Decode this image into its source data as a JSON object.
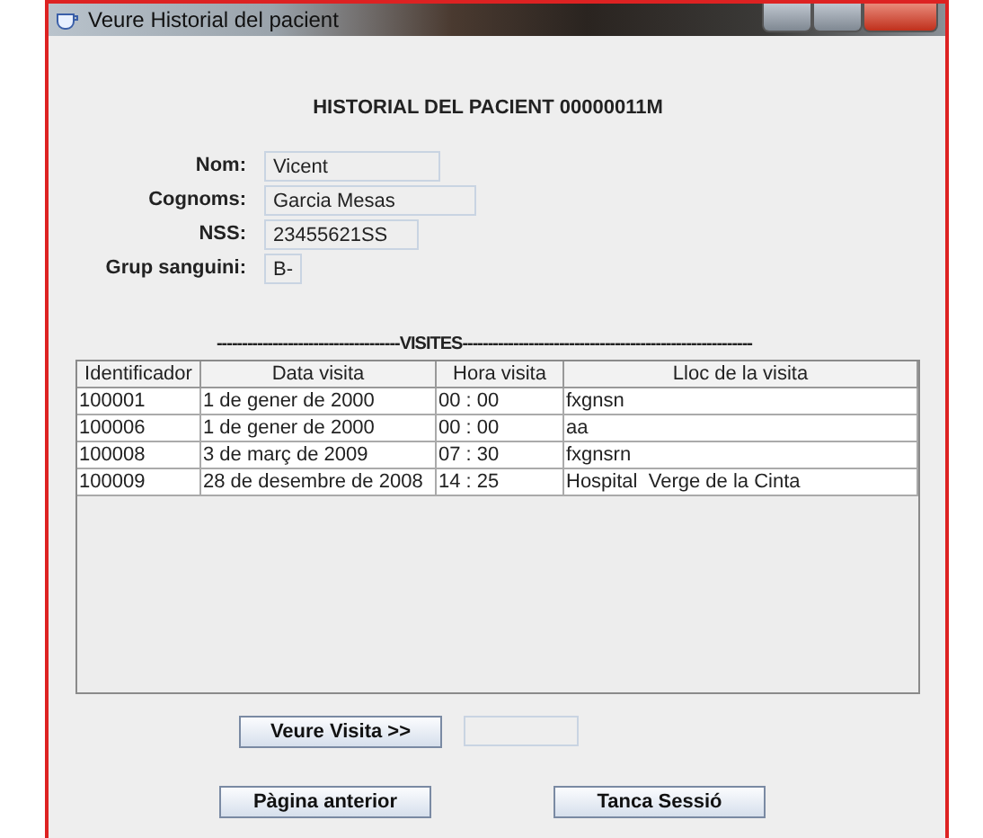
{
  "window": {
    "title": "Veure Historial del pacient"
  },
  "heading": "HISTORIAL DEL PACIENT 00000011M",
  "fields": [
    {
      "label": "Nom:",
      "value": "Vicent"
    },
    {
      "label": "Cognoms:",
      "value": "Garcia Mesas"
    },
    {
      "label": "NSS:",
      "value": "23455621SS"
    },
    {
      "label": "Grup sanguini:",
      "value": "B-"
    }
  ],
  "section_title": "------------------------------------VISITES---------------------------------------------------------",
  "table": {
    "columns": [
      "Identificador",
      "Data visita",
      "Hora visita",
      "Lloc de la visita"
    ],
    "rows": [
      [
        "100001",
        "1 de gener de 2000",
        "00 : 00",
        "fxgnsn"
      ],
      [
        "100006",
        "1 de gener de 2000",
        "00 : 00",
        "aa"
      ],
      [
        "100008",
        "3 de març de 2009",
        "07 : 30",
        "fxgnsrn"
      ],
      [
        "100009",
        "28 de desembre de 2008",
        "14 : 25",
        "Hospital  Verge de la Cinta"
      ]
    ]
  },
  "view_button": "Veure Visita >>",
  "buttons": [
    "Pàgina anterior",
    "Tanca Sessió"
  ]
}
